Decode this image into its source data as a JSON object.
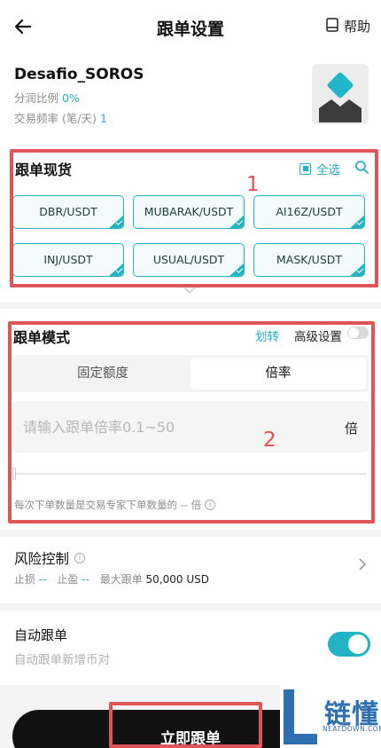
{
  "header": {
    "title": "跟单设置",
    "help_label": "帮助"
  },
  "trader": {
    "name": "Desafio_SOROS",
    "profit_share_label": "分润比例",
    "profit_share_value": "0%",
    "trade_freq_label": "交易频率 (笔/天)",
    "trade_freq_value": "1"
  },
  "spot": {
    "title": "跟单现货",
    "select_all_label": "全选",
    "coins": [
      "DBR/USDT",
      "MUBARAK/USDT",
      "AI16Z/USDT",
      "INJ/USDT",
      "USUAL/USDT",
      "MASK/USDT"
    ]
  },
  "mode": {
    "title": "跟单模式",
    "transfer_link": "划转",
    "advanced_label": "高级设置",
    "tabs": [
      "固定额度",
      "倍率"
    ],
    "active_tab": "倍率",
    "multiplier_placeholder": "请输入跟单倍率0.1~50",
    "unit": "倍",
    "hint": "每次下单数量是交易专家下单数量的 -- 倍"
  },
  "risk": {
    "title": "风险控制",
    "stop_loss_label": "止损",
    "stop_loss_value": "--",
    "take_profit_label": "止盈",
    "take_profit_value": "--",
    "max_follow_label": "最大跟单",
    "max_follow_value": "50,000 USD"
  },
  "auto": {
    "title": "自动跟单",
    "subtitle": "自动跟单新增币对",
    "enabled": true
  },
  "cta_label": "立即跟单",
  "annotations": {
    "box1_number": "1",
    "box2_number": "2"
  },
  "watermark": {
    "text": "链懂",
    "sub": "NEATDOWN.COM"
  },
  "colors": {
    "accent": "#23b3c2",
    "annotation_red": "#e05555",
    "cta_bg": "#121212"
  }
}
